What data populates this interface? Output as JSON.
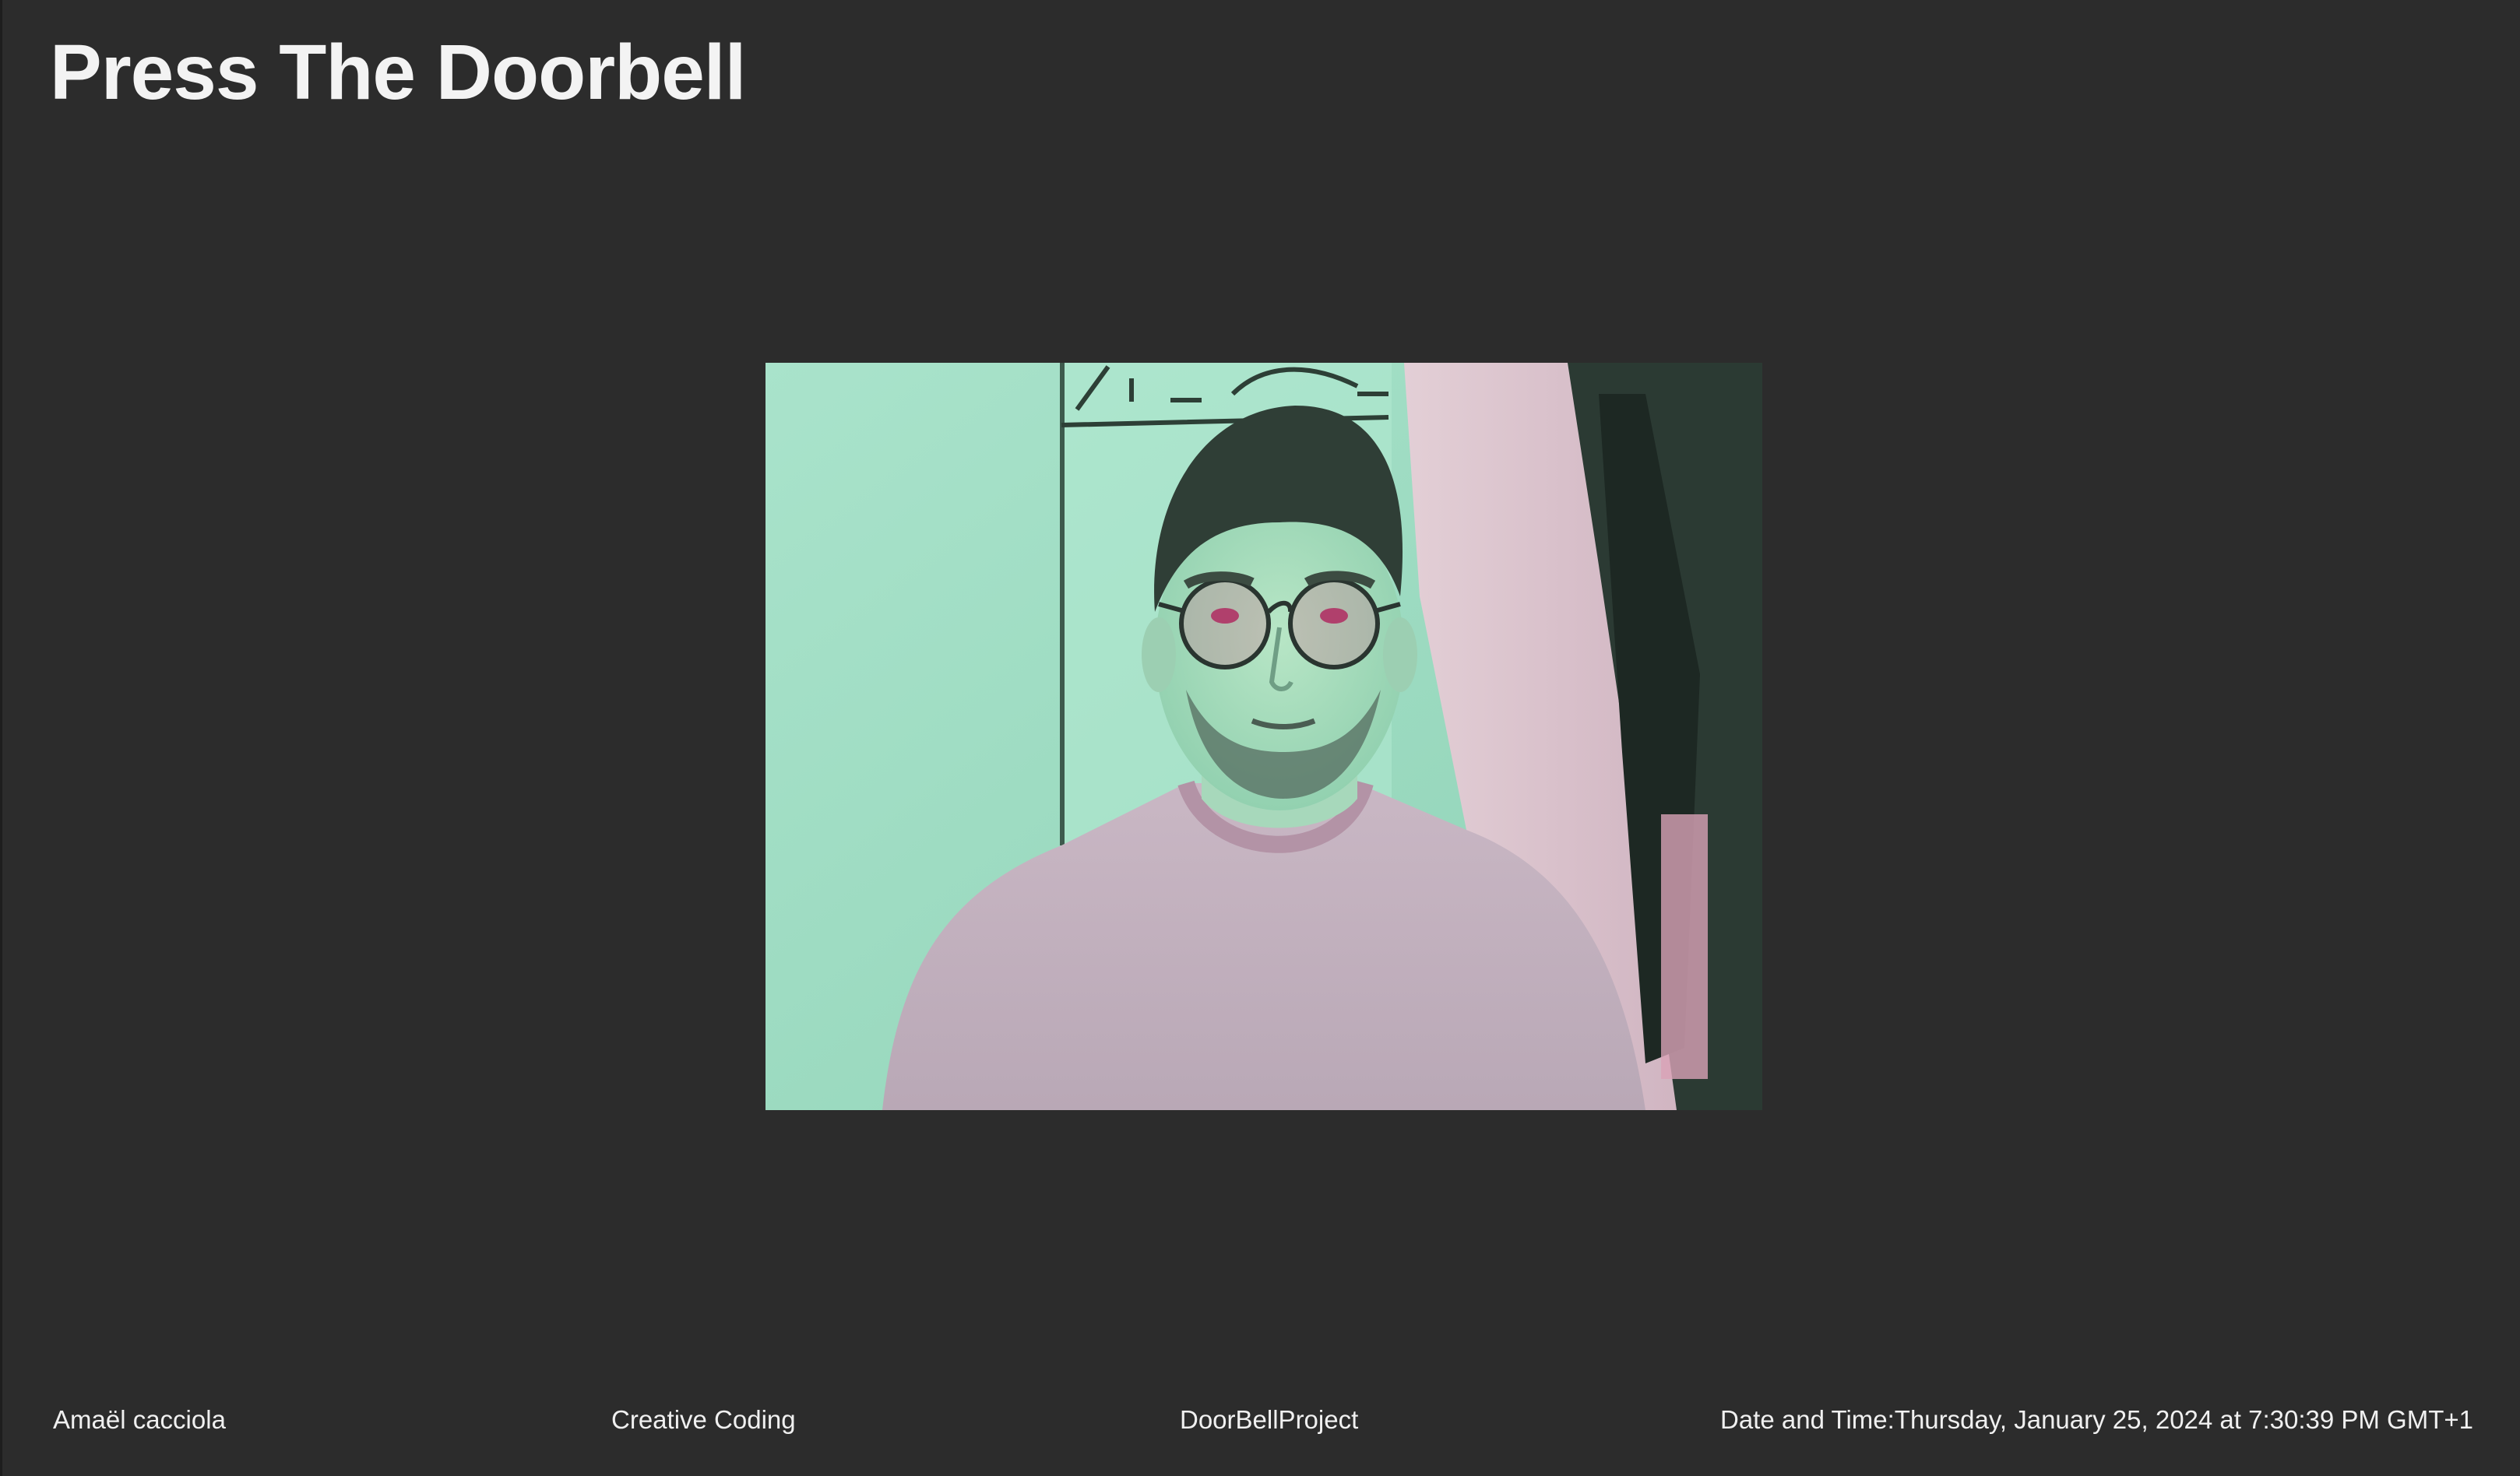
{
  "page": {
    "title": "Press The Doorbell"
  },
  "video": {
    "description_icon": "webcam-feed",
    "tint_color": "#9fdcc3"
  },
  "footer": {
    "author": "Amaël cacciola",
    "course": "Creative Coding",
    "project": "DoorBellProject",
    "datetime_label": "Date and Time:",
    "datetime_value": "Thursday, January 25, 2024 at 7:30:39 PM GMT+1"
  },
  "colors": {
    "background": "#2c2c2c",
    "text": "#f2f2f2"
  }
}
